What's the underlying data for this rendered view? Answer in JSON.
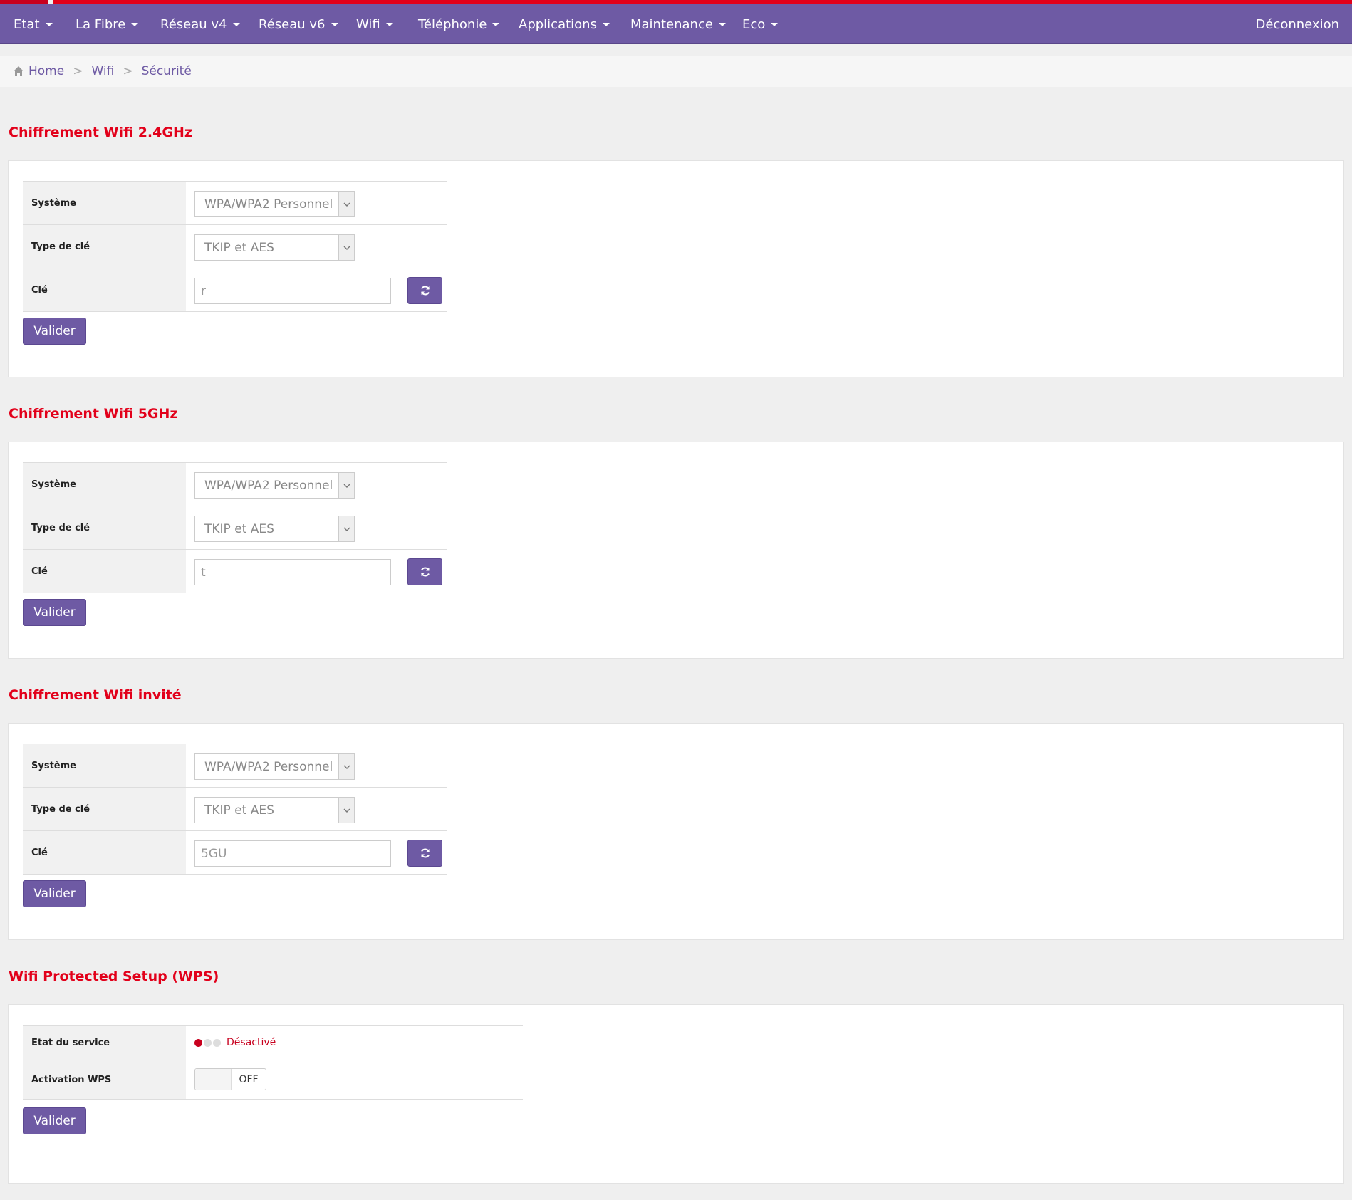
{
  "nav": {
    "items": [
      {
        "label": "Etat"
      },
      {
        "label": "La Fibre"
      },
      {
        "label": "Réseau v4"
      },
      {
        "label": "Réseau v6"
      },
      {
        "label": "Wifi"
      },
      {
        "label": "Téléphonie"
      },
      {
        "label": "Applications"
      },
      {
        "label": "Maintenance"
      },
      {
        "label": "Eco"
      }
    ],
    "logout": "Déconnexion"
  },
  "breadcrumb": {
    "home": "Home",
    "wifi": "Wifi",
    "current": "Sécurité"
  },
  "sections": [
    {
      "title": "Chiffrement Wifi 2.4GHz",
      "systeme_label": "Système",
      "systeme_value": "WPA/WPA2 Personnel",
      "type_label": "Type de clé",
      "type_value": "TKIP et AES",
      "cle_label": "Clé",
      "cle_value": "r",
      "valider": "Valider"
    },
    {
      "title": "Chiffrement Wifi 5GHz",
      "systeme_label": "Système",
      "systeme_value": "WPA/WPA2 Personnel",
      "type_label": "Type de clé",
      "type_value": "TKIP et AES",
      "cle_label": "Clé",
      "cle_value": "t",
      "valider": "Valider"
    },
    {
      "title": "Chiffrement Wifi invité",
      "systeme_label": "Système",
      "systeme_value": "WPA/WPA2 Personnel",
      "type_label": "Type de clé",
      "type_value": "TKIP et AES",
      "cle_label": "Clé",
      "cle_value": "5GU",
      "valider": "Valider"
    }
  ],
  "wps": {
    "title": "Wifi Protected Setup (WPS)",
    "etat_label": "Etat du service",
    "etat_value": "Désactivé",
    "activation_label": "Activation WPS",
    "toggle_state": "OFF",
    "valider": "Valider"
  },
  "colors": {
    "accent": "#6e5aa4",
    "title_red": "#e2001a",
    "status_red": "#c8001e"
  }
}
